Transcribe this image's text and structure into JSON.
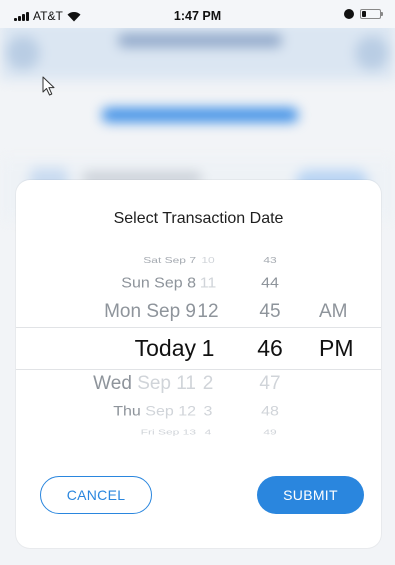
{
  "status_bar": {
    "carrier": "AT&T",
    "time": "1:47 PM",
    "icons": [
      "signal-icon",
      "wifi-icon",
      "alarm-icon",
      "battery-icon"
    ]
  },
  "modal": {
    "title": "Select Transaction Date",
    "picker": {
      "rows": [
        {
          "date": "Sat Sep 7",
          "hour": "10",
          "minute": "43",
          "ampm": ""
        },
        {
          "date": "Sun Sep 8",
          "hour": "11",
          "minute": "44",
          "ampm": ""
        },
        {
          "date": "Mon Sep 9",
          "hour": "12",
          "minute": "45",
          "ampm": "AM"
        },
        {
          "date": "Today",
          "hour": "1",
          "minute": "46",
          "ampm": "PM"
        },
        {
          "date_main": "Wed",
          "date_rest": "Sep 11",
          "hour": "2",
          "minute": "47",
          "ampm": ""
        },
        {
          "date_main": "Thu",
          "date_rest": "Sep 12",
          "hour": "3",
          "minute": "48",
          "ampm": ""
        },
        {
          "date": "Fri Sep 13",
          "hour": "4",
          "minute": "49",
          "ampm": ""
        }
      ],
      "selected_index": 3
    },
    "buttons": {
      "cancel": "CANCEL",
      "submit": "SUBMIT"
    }
  },
  "colors": {
    "accent": "#2a86de",
    "text": "#1f1f1f",
    "dim_text": "#d0d4d9"
  }
}
